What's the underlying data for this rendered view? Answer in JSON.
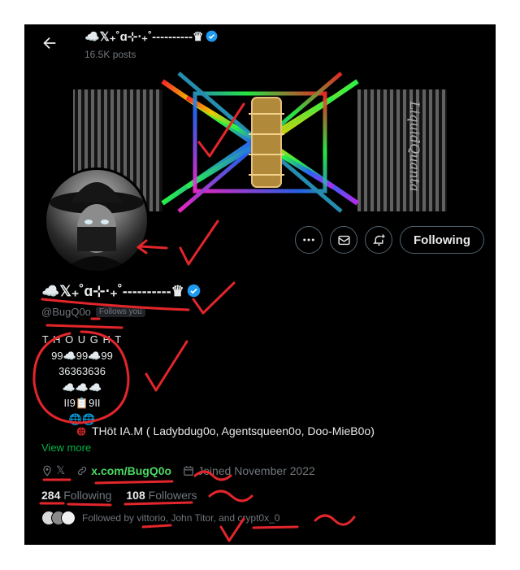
{
  "header": {
    "name": "☁️𝕏₊˚ɑ⊹‧₊˚----------♛",
    "posts": "16.5K posts"
  },
  "banner": {
    "signature": "LiquidQuanta"
  },
  "actions": {
    "more_icon": "more-icon",
    "message_icon": "envelope-icon",
    "notify_icon": "bell-plus-icon",
    "follow_label": "Following"
  },
  "profile": {
    "name": "☁️𝕏₊˚ɑ⊹‧₊˚----------♛",
    "handle": "@BugQ0o",
    "follows_you": "Follows you"
  },
  "bio": {
    "lines": [
      "T H O U G H T",
      "99☁️99☁️99",
      "36363636",
      "☁️☁️☁️",
      "II9📋9II",
      "🌐🌐"
    ],
    "tagline": "THöt  IA.M ( Ladybdug0o,   Agentsqueen0o,  Doo-MieB0o)",
    "tag_icon": "ladybug-icon",
    "view_more": "View more"
  },
  "meta": {
    "location": "𝕏",
    "url": "x.com/BugQ0o",
    "joined": "Joined November 2022"
  },
  "stats": {
    "following_count": "284",
    "following_label": "Following",
    "followers_count": "108",
    "followers_label": "Followers"
  },
  "followed_by": {
    "text": "Followed by vittorio, John Titor, and crypt0x_0"
  },
  "colors": {
    "background": "#000000",
    "accent_link": "#4cd964",
    "verified": "#1d9bf0",
    "annotation": "#e3262b"
  }
}
